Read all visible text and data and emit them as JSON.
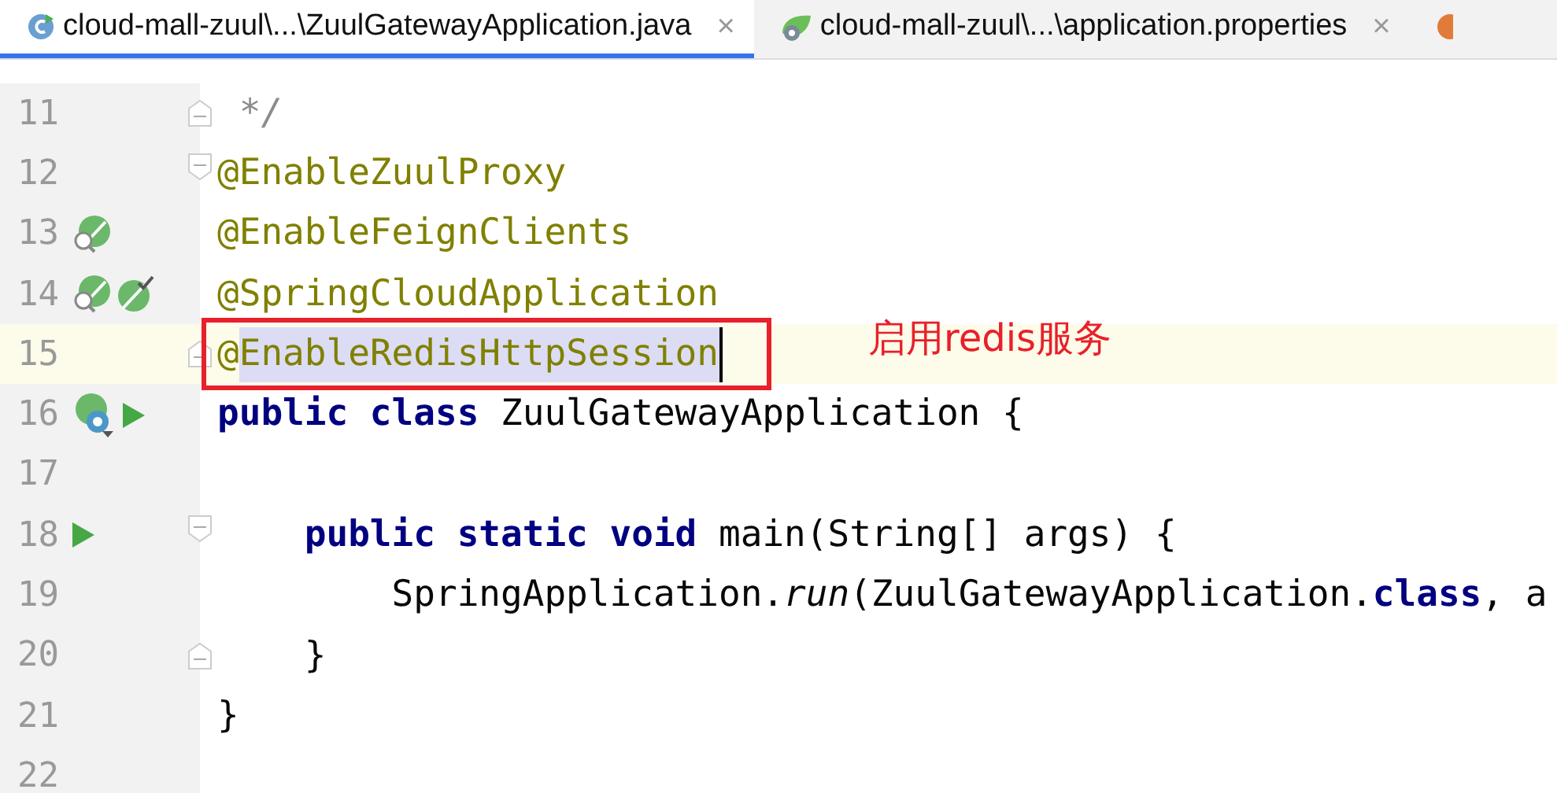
{
  "tabs": [
    {
      "label": "cloud-mall-zuul\\...\\ZuulGatewayApplication.java",
      "kind": "java",
      "selected": true,
      "close": "×"
    },
    {
      "label": "cloud-mall-zuul\\...\\application.properties",
      "kind": "properties",
      "selected": false,
      "close": "×"
    },
    {
      "kind": "other",
      "selected": false
    }
  ],
  "lines": [
    {
      "number": "11",
      "fold": {
        "kind": "end"
      },
      "tokens": [
        {
          "kind": "comment",
          "text": " */"
        }
      ]
    },
    {
      "number": "12",
      "fold": {
        "kind": "start"
      },
      "tokens": [
        {
          "kind": "annotation",
          "text": "@EnableZuulProxy"
        }
      ]
    },
    {
      "number": "13",
      "gutter": [
        {
          "kind": "bean"
        }
      ],
      "tokens": [
        {
          "kind": "annotation",
          "text": "@EnableFeignClients"
        }
      ]
    },
    {
      "number": "14",
      "gutter": [
        {
          "kind": "bean"
        },
        {
          "kind": "bean-check"
        }
      ],
      "tokens": [
        {
          "kind": "annotation",
          "text": "@SpringCloudApplication"
        }
      ]
    },
    {
      "number": "15",
      "fold": {
        "kind": "end"
      },
      "current": true,
      "tokens": [
        {
          "kind": "annotation",
          "text": "@"
        },
        {
          "kind": "annotation",
          "text": "EnableRedisHttpSession",
          "selected": true
        }
      ],
      "callout": {
        "text": "启用redis服务"
      }
    },
    {
      "number": "16",
      "gutter": [
        {
          "kind": "bean-run"
        },
        {
          "kind": "run"
        }
      ],
      "tokens": [
        {
          "kind": "keyword",
          "text": "public class "
        },
        {
          "kind": "plain",
          "text": "ZuulGatewayApplication {"
        }
      ]
    },
    {
      "number": "17"
    },
    {
      "number": "18",
      "fold": {
        "kind": "start"
      },
      "gutter": [
        {
          "kind": "run"
        }
      ],
      "tokens": [
        {
          "kind": "keyword",
          "text": "    public static void "
        },
        {
          "kind": "plain",
          "text": "main(String[] args) {"
        }
      ]
    },
    {
      "number": "19",
      "tokens": [
        {
          "kind": "plain",
          "text": "        SpringApplication."
        },
        {
          "kind": "italic",
          "text": "run"
        },
        {
          "kind": "plain",
          "text": "(ZuulGatewayApplication."
        },
        {
          "kind": "keyword",
          "text": "class"
        },
        {
          "kind": "plain",
          "text": ", a"
        }
      ]
    },
    {
      "number": "20",
      "fold": {
        "kind": "end"
      },
      "tokens": [
        {
          "kind": "plain",
          "text": "    }"
        }
      ]
    },
    {
      "number": "21",
      "tokens": [
        {
          "kind": "plain",
          "text": "}"
        }
      ]
    },
    {
      "number": "22"
    }
  ]
}
